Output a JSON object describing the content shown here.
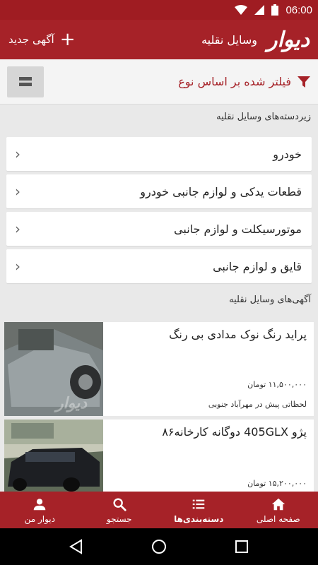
{
  "status_bar": {
    "time": "06:00"
  },
  "app_bar": {
    "logo": "دیوار",
    "title": "وسایل نقلیه",
    "new_ad_label": "آگهی جدید"
  },
  "filter": {
    "text": "فیلتر شده بر اساس نوع"
  },
  "subcategories": {
    "heading": "زیردسته‌های وسایل نقلیه",
    "items": [
      {
        "label": "خودرو"
      },
      {
        "label": "قطعات یدکی و لوازم جانبی خودرو"
      },
      {
        "label": "موتورسیکلت و لوازم جانبی"
      },
      {
        "label": "قایق و لوازم جانبی"
      }
    ]
  },
  "ads": {
    "heading": "آگهی‌های وسایل نقلیه",
    "items": [
      {
        "title": "پراید رنگ نوک مدادی بی رنگ",
        "price": "۱۱,۵۰۰,۰۰۰ تومان",
        "meta": "لحظاتی پیش در مهرآباد جنوبی",
        "thumb_watermark": "دیوار"
      },
      {
        "title": "پژو 405GLX دوگانه کارخانه۸۶",
        "price": "۱۵,۲۰۰,۰۰۰ تومان",
        "meta": ""
      }
    ]
  },
  "bottom_nav": {
    "items": [
      {
        "label": "صفحه اصلی",
        "icon": "home-icon"
      },
      {
        "label": "دسته‌بندی‌ها",
        "icon": "categories-icon"
      },
      {
        "label": "جستجو",
        "icon": "search-icon"
      },
      {
        "label": "دیوار من",
        "icon": "person-icon"
      }
    ],
    "active": "دسته‌بندی‌ها"
  },
  "colors": {
    "brand": "#a62228",
    "status": "#9f1c22",
    "background": "#e9e9e9"
  }
}
